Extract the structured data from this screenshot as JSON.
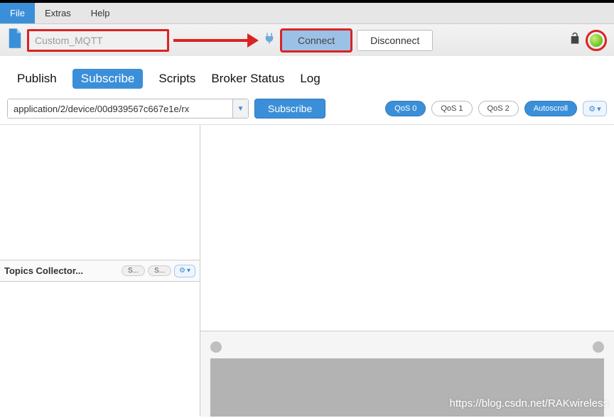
{
  "menu": {
    "file": "File",
    "extras": "Extras",
    "help": "Help"
  },
  "connection": {
    "name_placeholder": "Custom_MQTT",
    "connect_label": "Connect",
    "disconnect_label": "Disconnect"
  },
  "tabs": {
    "publish": "Publish",
    "subscribe": "Subscribe",
    "scripts": "Scripts",
    "broker_status": "Broker Status",
    "log": "Log"
  },
  "subscribe": {
    "topic_value": "application/2/device/00d939567c667e1e/rx",
    "button": "Subscribe",
    "qos0": "QoS 0",
    "qos1": "QoS 1",
    "qos2": "QoS 2",
    "autoscroll": "Autoscroll"
  },
  "topics_collector": {
    "title": "Topics Collector...",
    "s1": "S...",
    "s2": "S..."
  },
  "watermark": "https://blog.csdn.net/RAKwireless"
}
